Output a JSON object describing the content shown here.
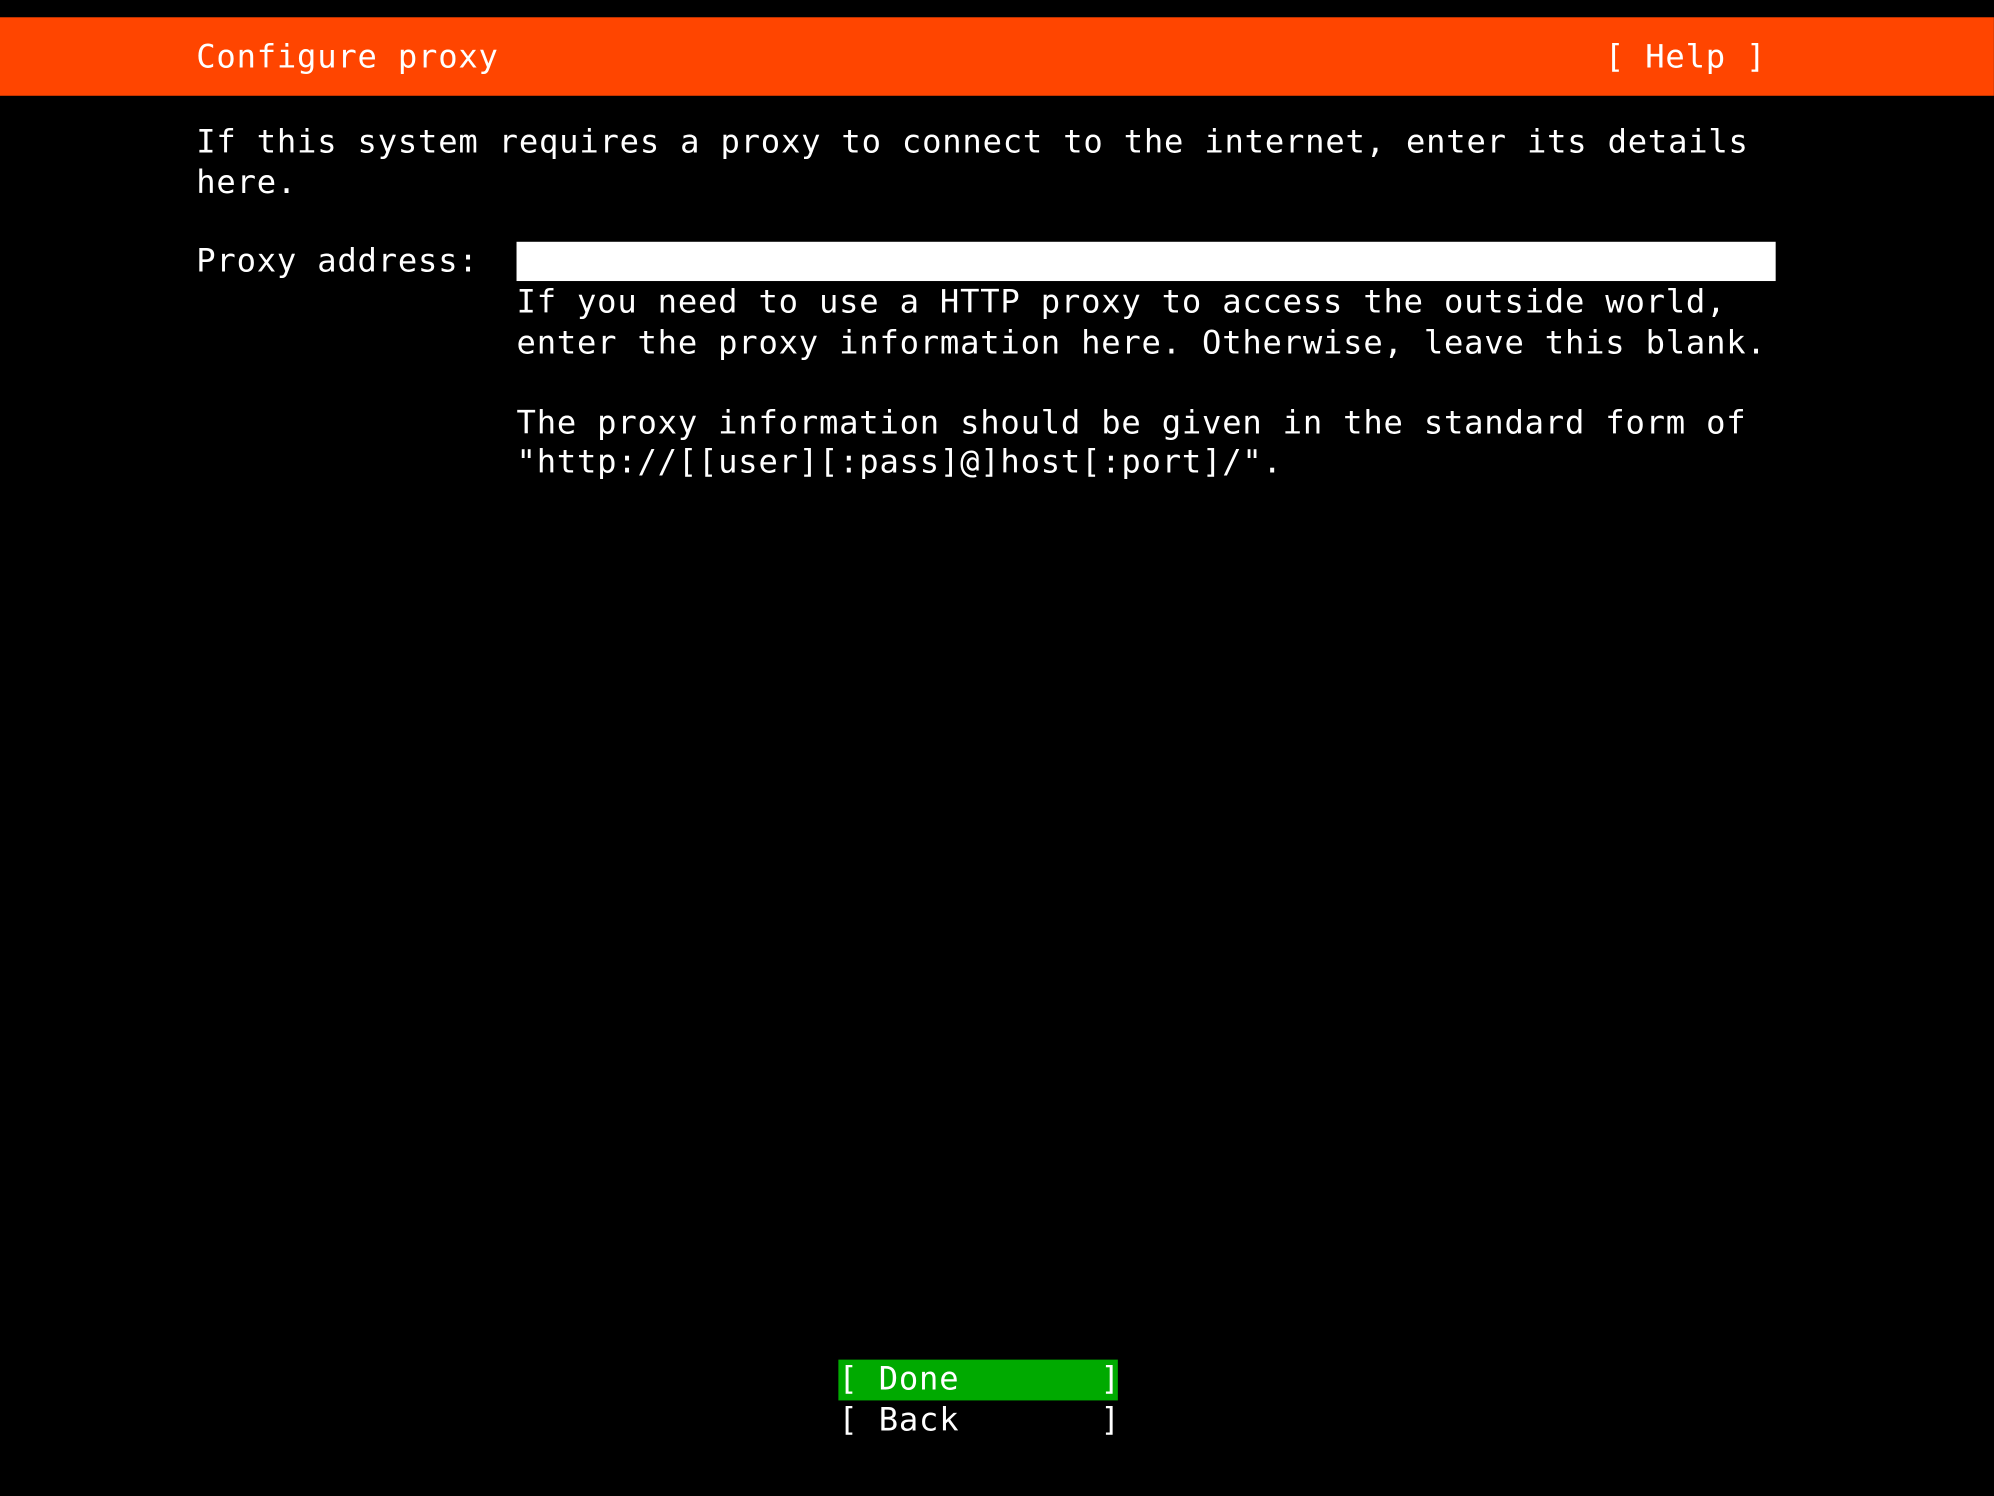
{
  "header": {
    "title": "Configure proxy",
    "help_label": "[ Help ]"
  },
  "main": {
    "description": "If this system requires a proxy to connect to the internet, enter its details here.",
    "proxy_label": "Proxy address:",
    "proxy_value": "",
    "proxy_help_1": "If you need to use a HTTP proxy to access the outside world, enter the proxy information here. Otherwise, leave this blank.",
    "proxy_help_2": "The proxy information should be given in the standard form of \"http://[[user][:pass]@]host[:port]/\"."
  },
  "buttons": {
    "done": "[ Done       ]",
    "back": "[ Back       ]"
  }
}
